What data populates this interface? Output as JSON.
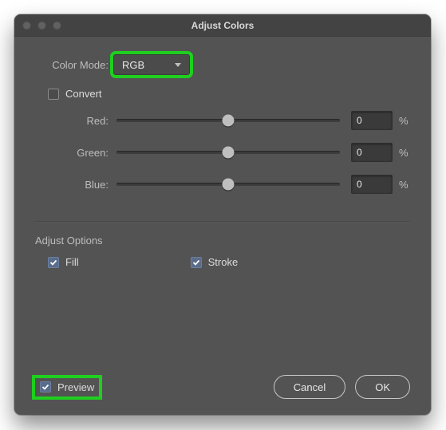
{
  "title": "Adjust Colors",
  "colorMode": {
    "label": "Color Mode:",
    "value": "RGB"
  },
  "convert": {
    "label": "Convert",
    "checked": false
  },
  "sliders": {
    "red": {
      "label": "Red:",
      "value": "0",
      "unit": "%"
    },
    "green": {
      "label": "Green:",
      "value": "0",
      "unit": "%"
    },
    "blue": {
      "label": "Blue:",
      "value": "0",
      "unit": "%"
    }
  },
  "adjustOptions": {
    "title": "Adjust Options",
    "fill": {
      "label": "Fill",
      "checked": true
    },
    "stroke": {
      "label": "Stroke",
      "checked": true
    }
  },
  "preview": {
    "label": "Preview",
    "checked": true
  },
  "buttons": {
    "cancel": "Cancel",
    "ok": "OK"
  }
}
